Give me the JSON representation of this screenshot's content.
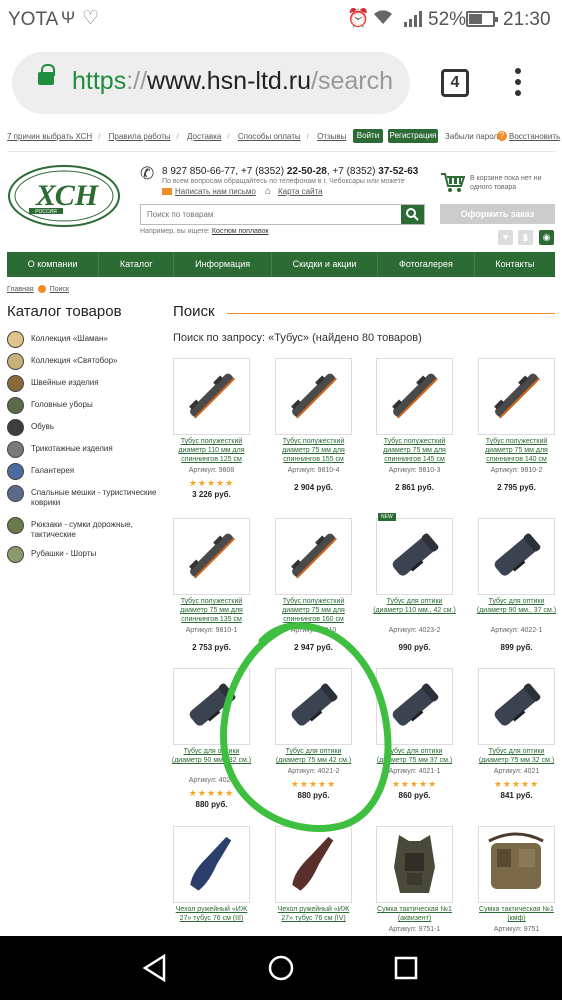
{
  "status_bar": {
    "carrier": "YOTA",
    "battery_percent": "52%",
    "time": "21:30",
    "battery_level": 0.52
  },
  "browser": {
    "url_scheme": "https",
    "url_sep": "://",
    "url_host": "www.hsn-ltd.ru",
    "url_rest": "/search",
    "tab_count": "4"
  },
  "top_links": [
    "7 причин выбрать ХСН",
    "Правила работы",
    "Доставка",
    "Способы оплаты",
    "Отзывы"
  ],
  "auth": {
    "login": "Войти",
    "register": "Регистрация",
    "forgot": "Забыли пароль",
    "restore": "Восстановить"
  },
  "logo": {
    "text": "ХСН",
    "subtext": "РОССИЯ"
  },
  "contacts": {
    "phones_prefix": "8 927 850-66-77",
    "phones_mid": ", +7 (8352) ",
    "phone2": "22-50-28",
    "phones_mid2": ", +7 (8352) ",
    "phone3": "37-52-63",
    "subtext": "По всем вопросам обращайтесь по телефонам в г. Чебоксары или можете",
    "mail_link": "Написать нам письмо",
    "map_link": "Карта сайта"
  },
  "cart": {
    "text": "В корзине пока нет ни одного товара",
    "order_button": "Оформить заказ"
  },
  "search": {
    "placeholder": "Поиск по товарам",
    "hint_prefix": "Например, вы ищете: ",
    "hint_link": "Костюм поплавок"
  },
  "nav": [
    "О компании",
    "Каталог",
    "Информация",
    "Скидки и акции",
    "Фотогалерея",
    "Контакты"
  ],
  "breadcrumbs": {
    "home": "Главная",
    "current": "Поиск"
  },
  "catalog": {
    "title": "Каталог товаров",
    "items": [
      "Коллекция «Шаман»",
      "Коллекция «Святобор»",
      "Швейные изделия",
      "Головные уборы",
      "Обувь",
      "Трикотажные изделия",
      "Галантерея",
      "Спальные мешки - туристические коврики",
      "Рюкзаки - сумки дорожные, тактические",
      "Рубашки - Шорты"
    ]
  },
  "results": {
    "title": "Поиск",
    "found_text": "Поиск по запросу: «Тубус» (найдено 80 товаров)",
    "products": [
      {
        "title": "Тубус полужесткий диаметр 110 мм для спиннингов 125 см",
        "sku": "Артикул: 9808",
        "rating": "★★★★★",
        "price": "3 226 руб.",
        "kind": "soft",
        "new": ""
      },
      {
        "title": "Тубус полужесткий диаметр 75 мм для спиннингов 155 см",
        "sku": "Артикул: 9810-4",
        "rating": "",
        "price": "2 904 руб.",
        "kind": "soft",
        "new": ""
      },
      {
        "title": "Тубус полужесткий диаметр 75 мм для спиннингов 145 см",
        "sku": "Артикул: 9810-3",
        "rating": "",
        "price": "2 861 руб.",
        "kind": "soft",
        "new": ""
      },
      {
        "title": "Тубус полужесткий диаметр 75 мм для спиннингов 140 см",
        "sku": "Артикул: 9810-2",
        "rating": "",
        "price": "2 795 руб.",
        "kind": "soft",
        "new": ""
      },
      {
        "title": "Тубус полужесткий диаметр 75 мм для спиннингов 135 см",
        "sku": "Артикул: 9810-1",
        "rating": "",
        "price": "2 753 руб.",
        "kind": "soft",
        "new": ""
      },
      {
        "title": "Тубус полужесткий диаметр 75 мм для спиннингов 160 см",
        "sku": "Артикул: 9810",
        "rating": "",
        "price": "2 947 руб.",
        "kind": "soft",
        "new": ""
      },
      {
        "title": "Тубус для оптики (диаметр 110 мм., 42 см.)",
        "sku": "Артикул: 4023-2",
        "rating": "",
        "price": "990 руб.",
        "kind": "hard",
        "new": "NEW"
      },
      {
        "title": "Тубус для оптики (диаметр 90 мм., 37 см.)",
        "sku": "Артикул: 4022-1",
        "rating": "",
        "price": "899 руб.",
        "kind": "hard",
        "new": ""
      },
      {
        "title": "Тубус для оптики (диаметр 90 мм., 32 см.)",
        "sku": "Артикул: 4022",
        "rating": "★★★★★",
        "price": "880 руб.",
        "kind": "hard",
        "new": ""
      },
      {
        "title": "Тубус для оптики (диаметр 75 мм 42 см.)",
        "sku": "Артикул: 4021-2",
        "rating": "★★★★★",
        "price": "880 руб.",
        "kind": "hard",
        "new": ""
      },
      {
        "title": "Тубус для оптики (диаметр 75 мм 37 см.)",
        "sku": "Артикул: 4021-1",
        "rating": "★★★★★",
        "price": "860 руб.",
        "kind": "hard",
        "new": ""
      },
      {
        "title": "Тубус для оптики (диаметр 75 мм 32 см.)",
        "sku": "Артикул: 4021",
        "rating": "★★★★★",
        "price": "841 руб.",
        "kind": "hard",
        "new": ""
      },
      {
        "title": "Чехол ружейный «ИЖ 27» тубус 76 см (III)",
        "sku": "",
        "rating": "",
        "price": "",
        "kind": "gunblue",
        "new": ""
      },
      {
        "title": "Чехол ружейный «ИЖ 27» тубус 76 см (IV)",
        "sku": "",
        "rating": "",
        "price": "",
        "kind": "gunbrown",
        "new": ""
      },
      {
        "title": "Сумка тактическая №1 (аквизент)",
        "sku": "Артикул: 9751-1",
        "rating": "",
        "price": "",
        "kind": "vest",
        "new": ""
      },
      {
        "title": "Сумка тактическая №1 (кмф)",
        "sku": "Артикул: 9751",
        "rating": "",
        "price": "",
        "kind": "bag",
        "new": ""
      }
    ]
  },
  "colors": {
    "brand_green": "#2c6b34",
    "accent_orange": "#f28c28",
    "star": "#f5a623",
    "annotation": "#3fbf3f"
  }
}
